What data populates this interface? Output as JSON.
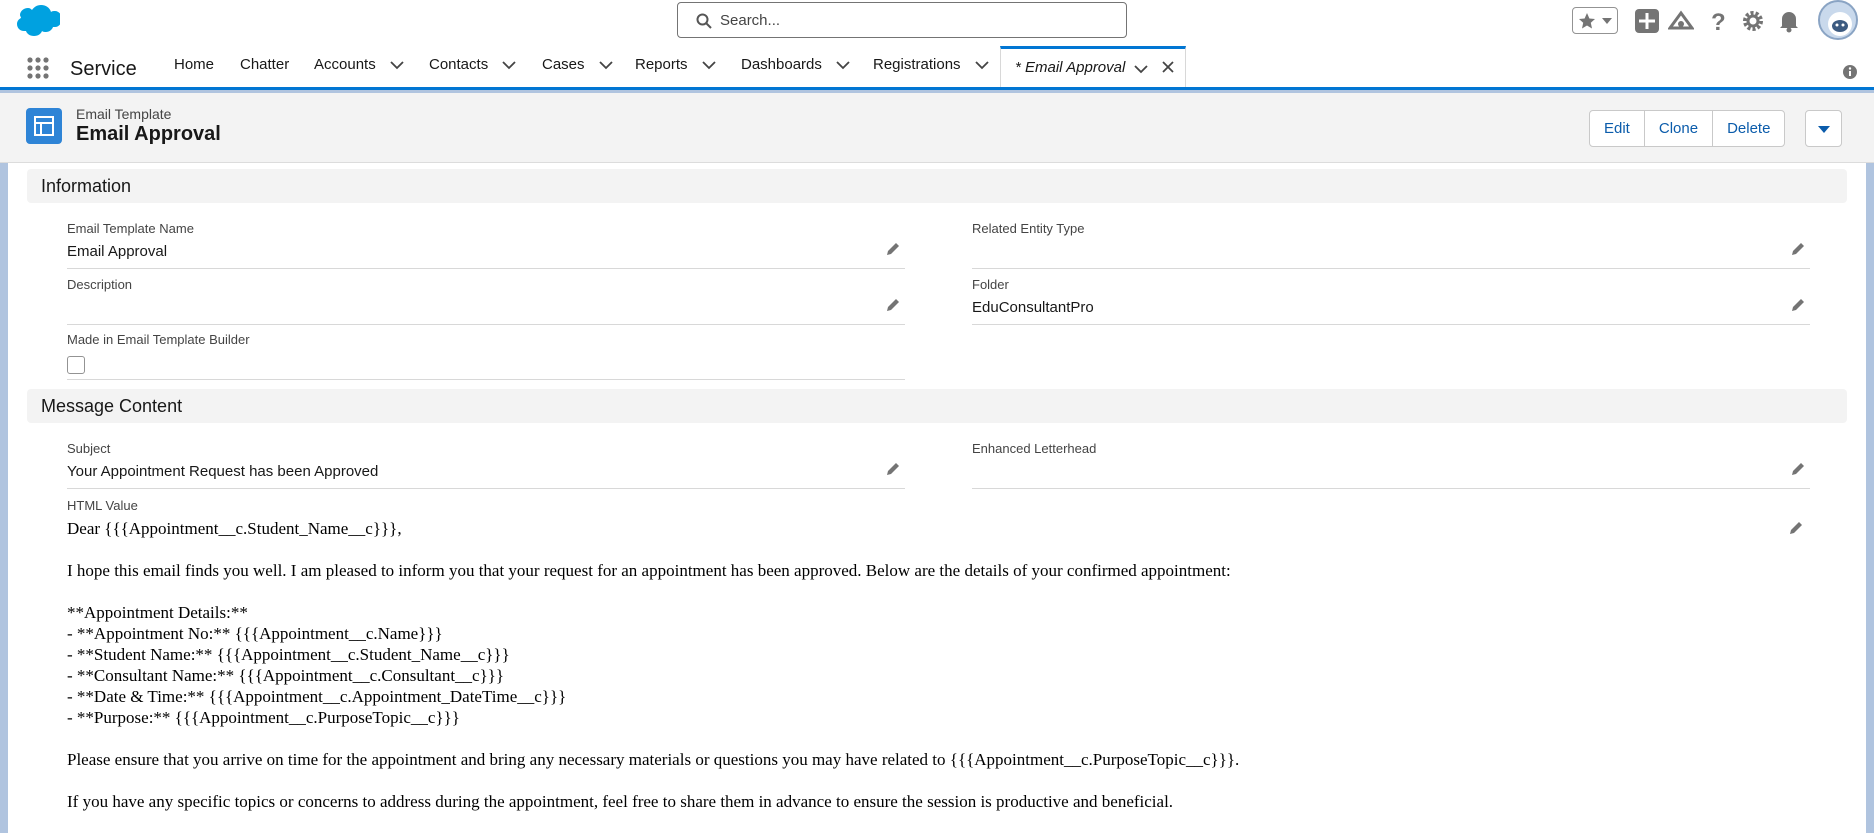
{
  "global_header": {
    "search_placeholder": "Search...",
    "icons": [
      "salesforce-logo",
      "search-icon",
      "star-icon",
      "chevron-down-icon",
      "add-icon",
      "trailhead-icon",
      "help-icon",
      "gear-icon",
      "bell-icon",
      "avatar"
    ]
  },
  "nav": {
    "app_name": "Service",
    "items": [
      {
        "label": "Home",
        "has_menu": false
      },
      {
        "label": "Chatter",
        "has_menu": false
      },
      {
        "label": "Accounts",
        "has_menu": true
      },
      {
        "label": "Contacts",
        "has_menu": true
      },
      {
        "label": "Cases",
        "has_menu": true
      },
      {
        "label": "Reports",
        "has_menu": true
      },
      {
        "label": "Dashboards",
        "has_menu": true
      },
      {
        "label": "Registrations",
        "has_menu": true
      }
    ],
    "active_tab": "* Email Approval"
  },
  "page_header": {
    "object_type": "Email Template",
    "record_title": "Email Approval",
    "actions": [
      "Edit",
      "Clone",
      "Delete"
    ]
  },
  "sections": {
    "information": {
      "title": "Information",
      "fields": {
        "template_name": {
          "label": "Email Template Name",
          "value": "Email Approval"
        },
        "related_entity": {
          "label": "Related Entity Type",
          "value": ""
        },
        "description": {
          "label": "Description",
          "value": ""
        },
        "folder": {
          "label": "Folder",
          "value": "EduConsultantPro"
        },
        "builder": {
          "label": "Made in Email Template Builder",
          "checked": false
        }
      }
    },
    "message_content": {
      "title": "Message Content",
      "fields": {
        "subject": {
          "label": "Subject",
          "value": "Your Appointment Request has been Approved"
        },
        "letterhead": {
          "label": "Enhanced Letterhead",
          "value": ""
        },
        "html_value": {
          "label": "HTML Value",
          "greeting": "Dear {{{Appointment__c.Student_Name__c}}},",
          "intro": "I hope this email finds you well. I am pleased to inform you that your request for an appointment has been approved. Below are the details of your confirmed appointment:",
          "details_heading": "**Appointment Details:**",
          "details": [
            "- **Appointment No:** {{{Appointment__c.Name}}}",
            "- **Student Name:** {{{Appointment__c.Student_Name__c}}}",
            "- **Consultant Name:** {{{Appointment__c.Consultant__c}}}",
            "- **Date & Time:** {{{Appointment__c.Appointment_DateTime__c}}}",
            "- **Purpose:** {{{Appointment__c.PurposeTopic__c}}}"
          ],
          "reminder": "Please ensure that you arrive on time for the appointment and bring any necessary materials or questions you may have related to {{{Appointment__c.PurposeTopic__c}}}.",
          "closing": "If you have any specific topics or concerns to address during the appointment, feel free to share them in advance to ensure the session is productive and beneficial."
        }
      }
    }
  },
  "colors": {
    "brand": "#0176d3",
    "link": "#0b5cab",
    "object_icon": "#2e84d6",
    "backdrop": "#b0c4df"
  }
}
